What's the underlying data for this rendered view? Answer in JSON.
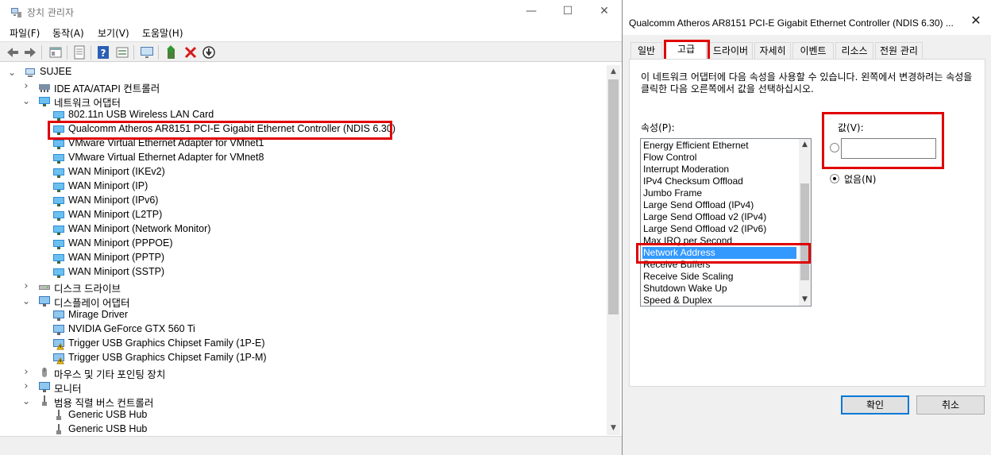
{
  "device_manager": {
    "title": "장치 관리자",
    "window_controls": {
      "minimize": "—",
      "maximize": "☐",
      "close": "✕"
    },
    "menu": [
      "파일(F)",
      "동작(A)",
      "보기(V)",
      "도움말(H)"
    ],
    "toolbar_icons": [
      "back-icon",
      "forward-icon",
      "show-hide-icon",
      "properties-icon",
      "help-icon",
      "view-icon",
      "monitor-icon",
      "update-driver-icon",
      "uninstall-icon",
      "disable-icon"
    ],
    "tree": [
      {
        "label": "SUJEE",
        "level": 0,
        "expander": "v",
        "icon": "computer"
      },
      {
        "label": "IDE ATA/ATAPI 컨트롤러",
        "level": 1,
        "expander": ">",
        "icon": "ide"
      },
      {
        "label": "네트워크 어댑터",
        "level": 1,
        "expander": "v",
        "icon": "net"
      },
      {
        "label": "802.11n USB Wireless LAN Card",
        "level": 2,
        "icon": "net"
      },
      {
        "label": "Qualcomm Atheros AR8151 PCI-E Gigabit Ethernet Controller (NDIS 6.30)",
        "level": 2,
        "icon": "net"
      },
      {
        "label": "VMware Virtual Ethernet Adapter for VMnet1",
        "level": 2,
        "icon": "net"
      },
      {
        "label": "VMware Virtual Ethernet Adapter for VMnet8",
        "level": 2,
        "icon": "net"
      },
      {
        "label": "WAN Miniport (IKEv2)",
        "level": 2,
        "icon": "net"
      },
      {
        "label": "WAN Miniport (IP)",
        "level": 2,
        "icon": "net"
      },
      {
        "label": "WAN Miniport (IPv6)",
        "level": 2,
        "icon": "net"
      },
      {
        "label": "WAN Miniport (L2TP)",
        "level": 2,
        "icon": "net"
      },
      {
        "label": "WAN Miniport (Network Monitor)",
        "level": 2,
        "icon": "net"
      },
      {
        "label": "WAN Miniport (PPPOE)",
        "level": 2,
        "icon": "net"
      },
      {
        "label": "WAN Miniport (PPTP)",
        "level": 2,
        "icon": "net"
      },
      {
        "label": "WAN Miniport (SSTP)",
        "level": 2,
        "icon": "net"
      },
      {
        "label": "디스크 드라이브",
        "level": 1,
        "expander": ">",
        "icon": "disk"
      },
      {
        "label": "디스플레이 어댑터",
        "level": 1,
        "expander": "v",
        "icon": "display"
      },
      {
        "label": "Mirage Driver",
        "level": 2,
        "icon": "display"
      },
      {
        "label": "NVIDIA GeForce GTX 560 Ti",
        "level": 2,
        "icon": "display"
      },
      {
        "label": "Trigger USB Graphics Chipset Family (1P-E)",
        "level": 2,
        "icon": "warning"
      },
      {
        "label": "Trigger USB Graphics Chipset Family (1P-M)",
        "level": 2,
        "icon": "warning"
      },
      {
        "label": "마우스 및 기타 포인팅 장치",
        "level": 1,
        "expander": ">",
        "icon": "mouse"
      },
      {
        "label": "모니터",
        "level": 1,
        "expander": ">",
        "icon": "display"
      },
      {
        "label": "범용 직렬 버스 컨트롤러",
        "level": 1,
        "expander": "v",
        "icon": "usb"
      },
      {
        "label": "Generic USB Hub",
        "level": 2,
        "icon": "usb"
      },
      {
        "label": "Generic USB Hub",
        "level": 2,
        "icon": "usb"
      }
    ],
    "highlighted_item": "Qualcomm Atheros AR8151 PCI-E Gigabit Ethernet Controller (NDIS 6.30)"
  },
  "dialog": {
    "title": "Qualcomm Atheros AR8151 PCI-E Gigabit Ethernet Controller (NDIS 6.30) ...",
    "close": "✕",
    "tabs": [
      "일반",
      "고급",
      "드라이버",
      "자세히",
      "이벤트",
      "리소스",
      "전원 관리"
    ],
    "active_tab": "고급",
    "description": "이 네트워크 어댑터에 다음 속성을 사용할 수 있습니다. 왼쪽에서 변경하려는 속성을 클릭한 다음 오른쪽에서 값을 선택하십시오.",
    "property_label": "속성(P):",
    "properties": [
      "Energy Efficient Ethernet",
      "Flow Control",
      "Interrupt Moderation",
      "IPv4 Checksum Offload",
      "Jumbo Frame",
      "Large Send Offload (IPv4)",
      "Large Send Offload v2 (IPv4)",
      "Large Send Offload v2 (IPv6)",
      "Max IRQ per Second",
      "Network Address",
      "Receive Buffers",
      "Receive Side Scaling",
      "Shutdown Wake Up",
      "Speed & Duplex"
    ],
    "selected_property": "Network Address",
    "value_label": "값(V):",
    "value_input": "",
    "none_label": "없음(N)",
    "ok_label": "확인",
    "cancel_label": "취소"
  },
  "colors": {
    "highlight_red": "#e00000",
    "selection_blue": "#3399ff",
    "accent": "#0078d7"
  }
}
